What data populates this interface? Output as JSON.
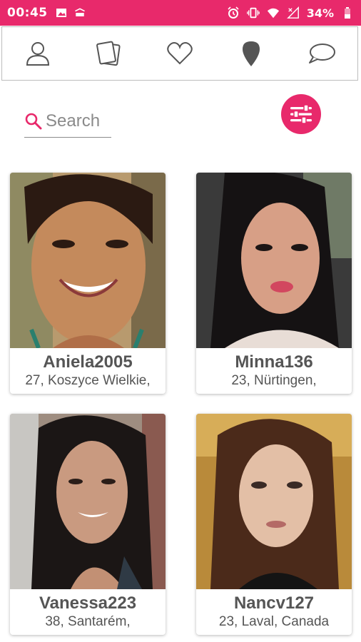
{
  "status_bar": {
    "time": "00:45",
    "battery": "34%",
    "left_icons": [
      "image-icon",
      "payment-app-icon"
    ],
    "right_icons": [
      "alarm-icon",
      "vibrate-icon",
      "wifi-icon",
      "signal-icon",
      "battery-icon"
    ]
  },
  "nav": {
    "items": [
      {
        "icon": "profile-icon"
      },
      {
        "icon": "cards-icon"
      },
      {
        "icon": "heart-icon"
      },
      {
        "icon": "location-pin-icon"
      },
      {
        "icon": "chat-icon"
      }
    ]
  },
  "search": {
    "placeholder": "Search",
    "value": ""
  },
  "filter": {
    "icon": "filter-sliders-icon"
  },
  "profiles": [
    {
      "name": "Aniela2005",
      "location": "27, Koszyce Wielkie,"
    },
    {
      "name": "Minna136",
      "location": "23, Nürtingen,"
    },
    {
      "name": "Vanessa223",
      "location": "38, Santarém,"
    },
    {
      "name": "Nancv127",
      "location": "23, Laval, Canada"
    }
  ],
  "colors": {
    "accent": "#e8296b",
    "text": "#555555",
    "nav_icon": "#555555"
  }
}
